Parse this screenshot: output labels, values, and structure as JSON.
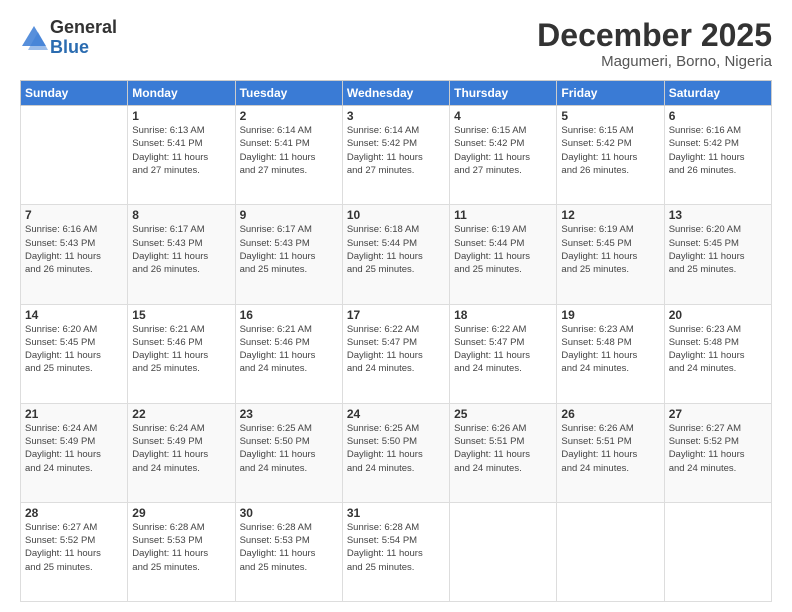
{
  "logo": {
    "general": "General",
    "blue": "Blue"
  },
  "header": {
    "month": "December 2025",
    "location": "Magumeri, Borno, Nigeria"
  },
  "days_of_week": [
    "Sunday",
    "Monday",
    "Tuesday",
    "Wednesday",
    "Thursday",
    "Friday",
    "Saturday"
  ],
  "weeks": [
    [
      {
        "day": "",
        "info": ""
      },
      {
        "day": "1",
        "info": "Sunrise: 6:13 AM\nSunset: 5:41 PM\nDaylight: 11 hours\nand 27 minutes."
      },
      {
        "day": "2",
        "info": "Sunrise: 6:14 AM\nSunset: 5:41 PM\nDaylight: 11 hours\nand 27 minutes."
      },
      {
        "day": "3",
        "info": "Sunrise: 6:14 AM\nSunset: 5:42 PM\nDaylight: 11 hours\nand 27 minutes."
      },
      {
        "day": "4",
        "info": "Sunrise: 6:15 AM\nSunset: 5:42 PM\nDaylight: 11 hours\nand 27 minutes."
      },
      {
        "day": "5",
        "info": "Sunrise: 6:15 AM\nSunset: 5:42 PM\nDaylight: 11 hours\nand 26 minutes."
      },
      {
        "day": "6",
        "info": "Sunrise: 6:16 AM\nSunset: 5:42 PM\nDaylight: 11 hours\nand 26 minutes."
      }
    ],
    [
      {
        "day": "7",
        "info": "Sunrise: 6:16 AM\nSunset: 5:43 PM\nDaylight: 11 hours\nand 26 minutes."
      },
      {
        "day": "8",
        "info": "Sunrise: 6:17 AM\nSunset: 5:43 PM\nDaylight: 11 hours\nand 26 minutes."
      },
      {
        "day": "9",
        "info": "Sunrise: 6:17 AM\nSunset: 5:43 PM\nDaylight: 11 hours\nand 25 minutes."
      },
      {
        "day": "10",
        "info": "Sunrise: 6:18 AM\nSunset: 5:44 PM\nDaylight: 11 hours\nand 25 minutes."
      },
      {
        "day": "11",
        "info": "Sunrise: 6:19 AM\nSunset: 5:44 PM\nDaylight: 11 hours\nand 25 minutes."
      },
      {
        "day": "12",
        "info": "Sunrise: 6:19 AM\nSunset: 5:45 PM\nDaylight: 11 hours\nand 25 minutes."
      },
      {
        "day": "13",
        "info": "Sunrise: 6:20 AM\nSunset: 5:45 PM\nDaylight: 11 hours\nand 25 minutes."
      }
    ],
    [
      {
        "day": "14",
        "info": "Sunrise: 6:20 AM\nSunset: 5:45 PM\nDaylight: 11 hours\nand 25 minutes."
      },
      {
        "day": "15",
        "info": "Sunrise: 6:21 AM\nSunset: 5:46 PM\nDaylight: 11 hours\nand 25 minutes."
      },
      {
        "day": "16",
        "info": "Sunrise: 6:21 AM\nSunset: 5:46 PM\nDaylight: 11 hours\nand 24 minutes."
      },
      {
        "day": "17",
        "info": "Sunrise: 6:22 AM\nSunset: 5:47 PM\nDaylight: 11 hours\nand 24 minutes."
      },
      {
        "day": "18",
        "info": "Sunrise: 6:22 AM\nSunset: 5:47 PM\nDaylight: 11 hours\nand 24 minutes."
      },
      {
        "day": "19",
        "info": "Sunrise: 6:23 AM\nSunset: 5:48 PM\nDaylight: 11 hours\nand 24 minutes."
      },
      {
        "day": "20",
        "info": "Sunrise: 6:23 AM\nSunset: 5:48 PM\nDaylight: 11 hours\nand 24 minutes."
      }
    ],
    [
      {
        "day": "21",
        "info": "Sunrise: 6:24 AM\nSunset: 5:49 PM\nDaylight: 11 hours\nand 24 minutes."
      },
      {
        "day": "22",
        "info": "Sunrise: 6:24 AM\nSunset: 5:49 PM\nDaylight: 11 hours\nand 24 minutes."
      },
      {
        "day": "23",
        "info": "Sunrise: 6:25 AM\nSunset: 5:50 PM\nDaylight: 11 hours\nand 24 minutes."
      },
      {
        "day": "24",
        "info": "Sunrise: 6:25 AM\nSunset: 5:50 PM\nDaylight: 11 hours\nand 24 minutes."
      },
      {
        "day": "25",
        "info": "Sunrise: 6:26 AM\nSunset: 5:51 PM\nDaylight: 11 hours\nand 24 minutes."
      },
      {
        "day": "26",
        "info": "Sunrise: 6:26 AM\nSunset: 5:51 PM\nDaylight: 11 hours\nand 24 minutes."
      },
      {
        "day": "27",
        "info": "Sunrise: 6:27 AM\nSunset: 5:52 PM\nDaylight: 11 hours\nand 24 minutes."
      }
    ],
    [
      {
        "day": "28",
        "info": "Sunrise: 6:27 AM\nSunset: 5:52 PM\nDaylight: 11 hours\nand 25 minutes."
      },
      {
        "day": "29",
        "info": "Sunrise: 6:28 AM\nSunset: 5:53 PM\nDaylight: 11 hours\nand 25 minutes."
      },
      {
        "day": "30",
        "info": "Sunrise: 6:28 AM\nSunset: 5:53 PM\nDaylight: 11 hours\nand 25 minutes."
      },
      {
        "day": "31",
        "info": "Sunrise: 6:28 AM\nSunset: 5:54 PM\nDaylight: 11 hours\nand 25 minutes."
      },
      {
        "day": "",
        "info": ""
      },
      {
        "day": "",
        "info": ""
      },
      {
        "day": "",
        "info": ""
      }
    ]
  ]
}
